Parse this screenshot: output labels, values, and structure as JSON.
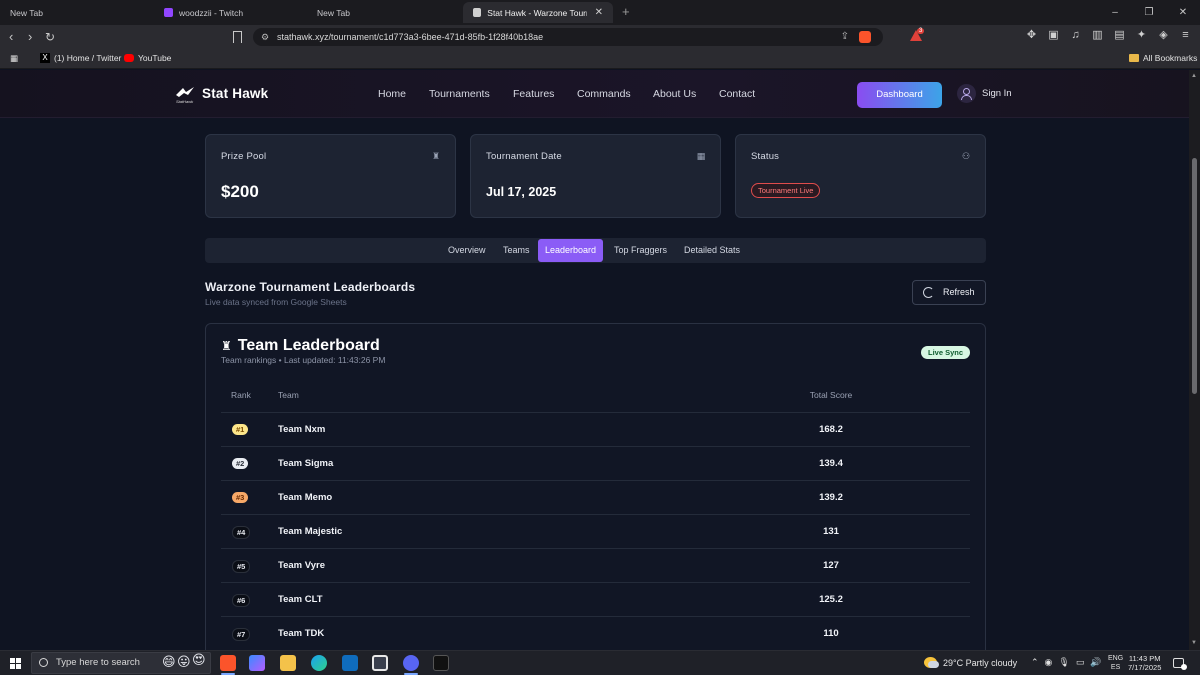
{
  "browser": {
    "tabs": [
      {
        "title": "New Tab"
      },
      {
        "title": "woodzzii - Twitch"
      },
      {
        "title": "New Tab"
      },
      {
        "title": "Stat Hawk - Warzone Tourname"
      }
    ],
    "new_tab_symbol": "+",
    "window_controls": {
      "minimize": "–",
      "restore": "❐",
      "close": "✕"
    },
    "url": "stathawk.xyz/tournament/c1d773a3-6bee-471d-85fb-1f28f40b18ae",
    "brave_badge_count": "3",
    "bookmarks": [
      {
        "label": "(1) Home / Twitter",
        "icon": "x-icon"
      },
      {
        "label": "YouTube",
        "icon": "youtube-icon"
      }
    ],
    "all_bookmarks": "All Bookmarks"
  },
  "site": {
    "logo_text": "Stat Hawk",
    "logo_sub": "StatHawk",
    "nav": [
      "Home",
      "Tournaments",
      "Features",
      "Commands",
      "About Us",
      "Contact"
    ],
    "dashboard_label": "Dashboard",
    "signin_label": "Sign In",
    "cards": {
      "prize_pool": {
        "label": "Prize Pool",
        "value": "$200",
        "icon": "trophy-icon"
      },
      "date": {
        "label": "Tournament Date",
        "value": "Jul 17, 2025",
        "icon": "calendar-icon"
      },
      "status": {
        "label": "Status",
        "value": "Tournament Live",
        "icon": "users-icon"
      }
    },
    "tabs": [
      "Overview",
      "Teams",
      "Leaderboard",
      "Top Fraggers",
      "Detailed Stats"
    ],
    "active_tab": "Leaderboard",
    "section_title": "Warzone Tournament Leaderboards",
    "section_sub": "Live data synced from Google Sheets",
    "refresh_label": "Refresh",
    "board": {
      "title": "Team Leaderboard",
      "subtitle": "Team rankings • Last updated: 11:43:26 PM",
      "live_badge": "Live Sync",
      "columns": {
        "rank": "Rank",
        "team": "Team",
        "score": "Total Score"
      },
      "rows": [
        {
          "rank": "#1",
          "team": "Team Nxm",
          "score": "168.2"
        },
        {
          "rank": "#2",
          "team": "Team Sigma",
          "score": "139.4"
        },
        {
          "rank": "#3",
          "team": "Team Memo",
          "score": "139.2"
        },
        {
          "rank": "#4",
          "team": "Team Majestic",
          "score": "131"
        },
        {
          "rank": "#5",
          "team": "Team Vyre",
          "score": "127"
        },
        {
          "rank": "#6",
          "team": "Team CLT",
          "score": "125.2"
        },
        {
          "rank": "#7",
          "team": "Team TDK",
          "score": "110"
        }
      ]
    }
  },
  "taskbar": {
    "search_placeholder": "Type here to search",
    "weather": "29°C  Partly cloudy",
    "lang_top": "ENG",
    "lang_bottom": "ES",
    "time": "11:43 PM",
    "date": "7/17/2025"
  }
}
